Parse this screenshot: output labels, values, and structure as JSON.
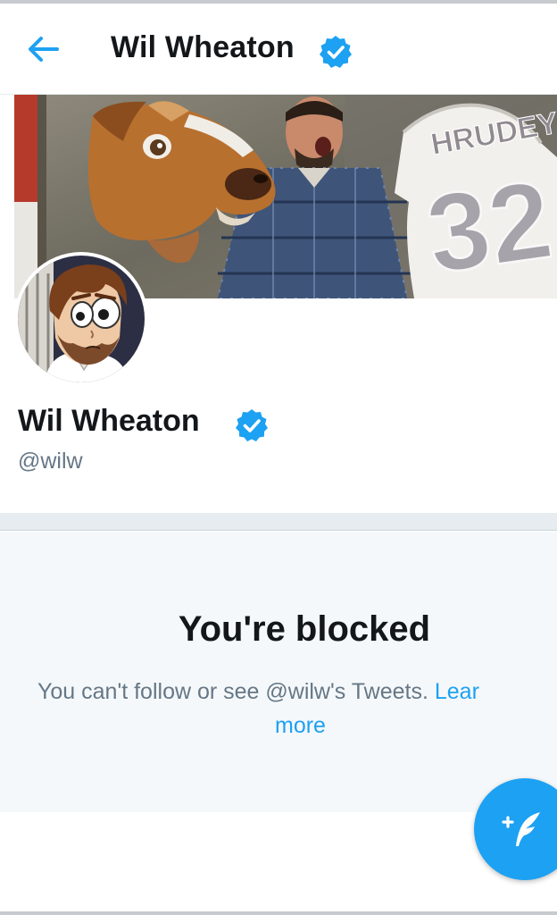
{
  "header": {
    "back_icon": "arrow-left-icon",
    "title": "Wil Wheaton",
    "verified_icon": "verified-badge-icon"
  },
  "banner": {
    "jersey_text": "HRUDEY",
    "jersey_number": "32"
  },
  "profile": {
    "avatar_icon": "avatar",
    "name": "Wil Wheaton",
    "verified_icon": "verified-badge-icon",
    "handle": "@wilw"
  },
  "blocked": {
    "title": "You're blocked",
    "message": "You can't follow or see @wilw's Tweets.",
    "link_part1": "Lear",
    "link_part2": "more"
  },
  "fab": {
    "icon": "compose-tweet-icon"
  },
  "colors": {
    "accent": "#1da1f2",
    "text_primary": "#14171a",
    "text_secondary": "#657786",
    "panel_bg": "#f5f8fa",
    "divider": "#e6ecf0"
  }
}
